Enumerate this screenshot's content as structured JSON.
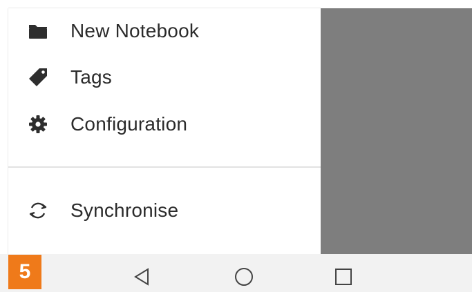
{
  "drawer": {
    "items": [
      {
        "label": "New Notebook",
        "icon": "folder-icon"
      },
      {
        "label": "Tags",
        "icon": "tag-icon"
      },
      {
        "label": "Configuration",
        "icon": "gear-icon"
      }
    ],
    "sync": {
      "label": "Synchronise",
      "icon": "sync-icon"
    }
  },
  "figure_badge": "5",
  "navbar": {
    "buttons": [
      "back-icon",
      "home-icon",
      "recents-icon"
    ]
  },
  "colors": {
    "scrim": "#7e7e7e",
    "badge": "#ef7a1a",
    "text": "#2b2b2b",
    "navbar": "#f2f2f2"
  }
}
